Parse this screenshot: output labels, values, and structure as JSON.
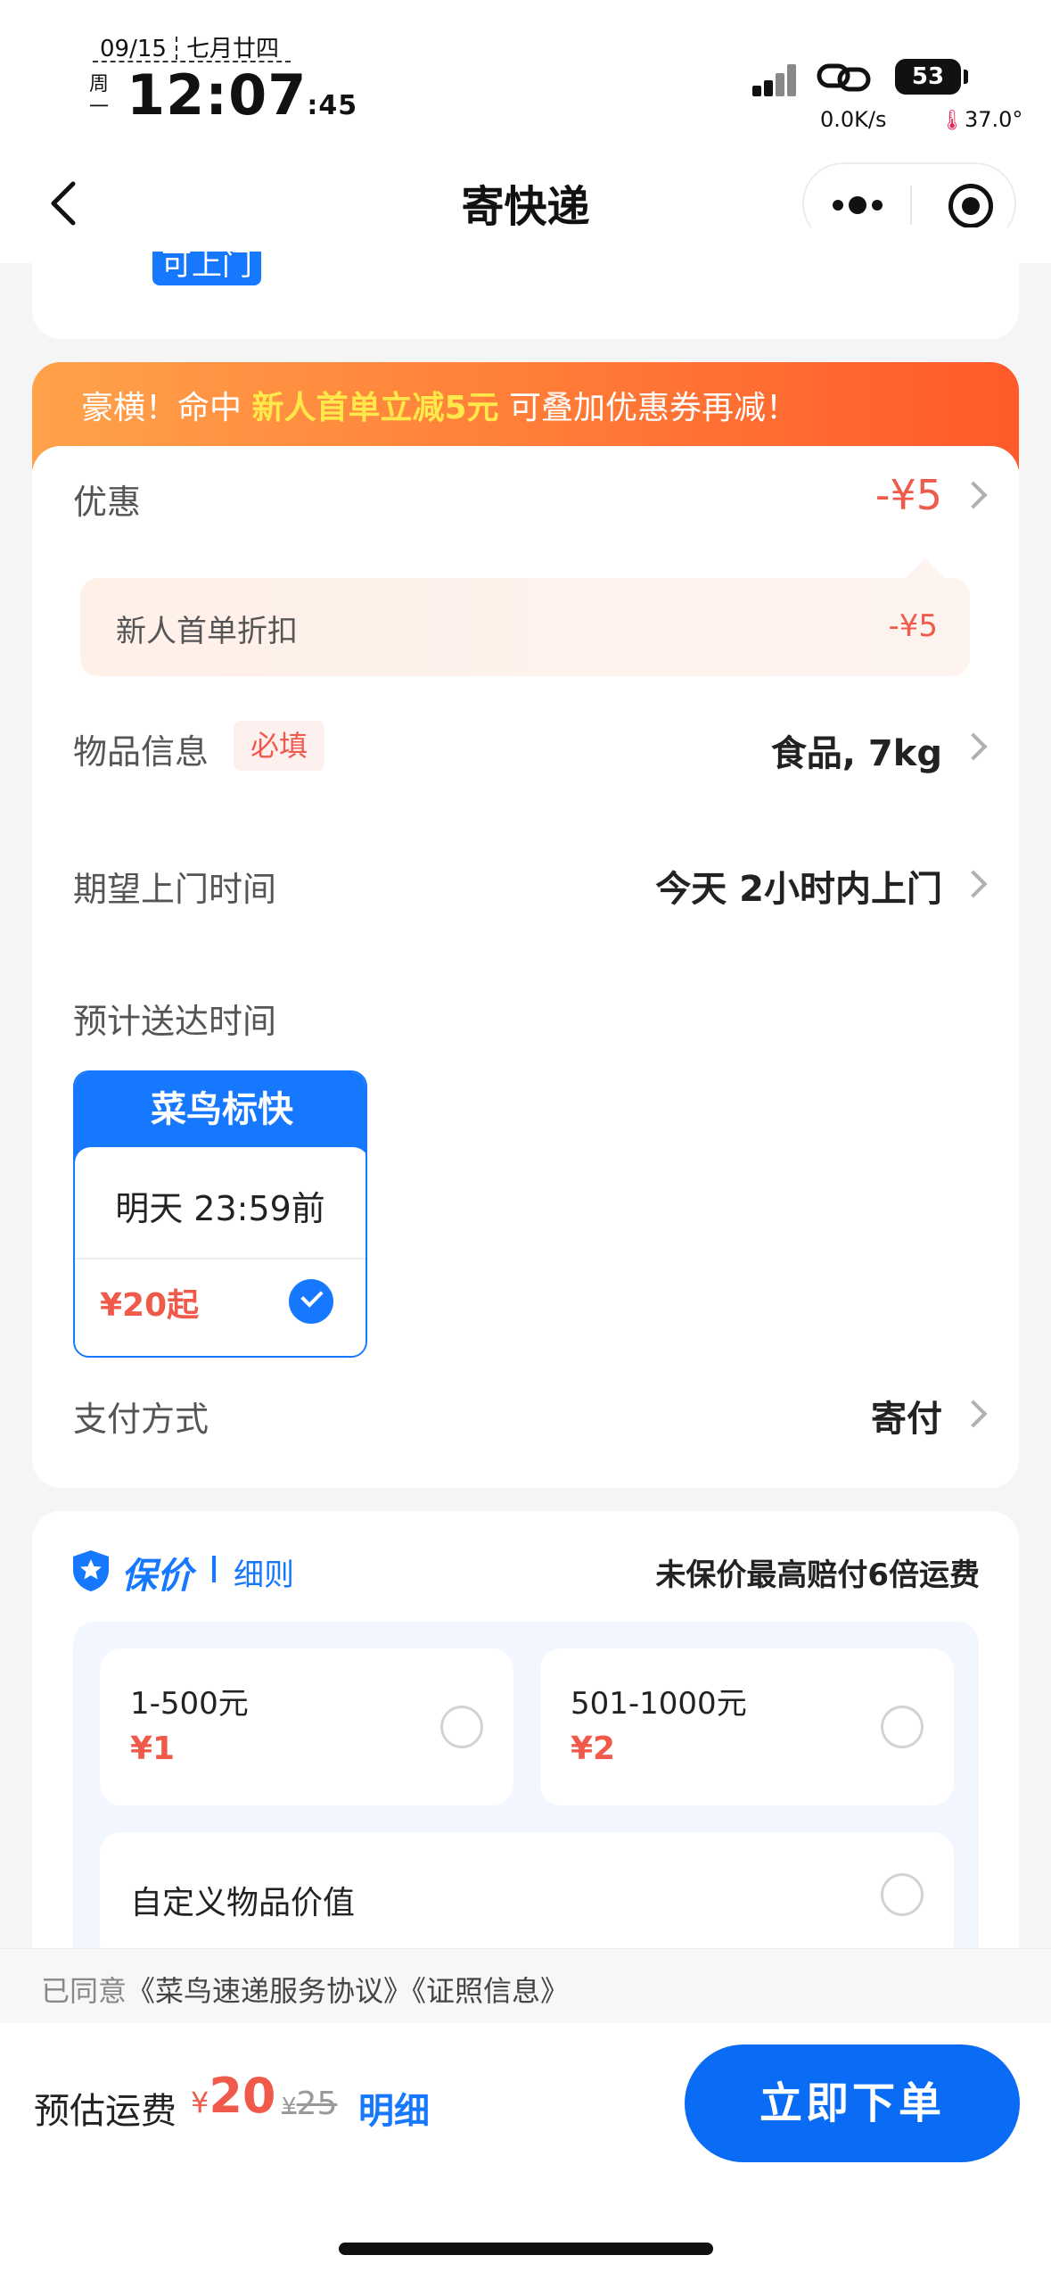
{
  "status_bar": {
    "date": "09/15",
    "lunar": "七月廿四",
    "weekday": "周一",
    "time": "12:07",
    "seconds": ":45",
    "battery": "53",
    "speed": "0.0K/s",
    "temperature": "37.0°"
  },
  "nav": {
    "title": "寄快递"
  },
  "top_card": {
    "tag": "可上门"
  },
  "banner": {
    "text_prefix": "豪横！命中 ",
    "text_highlight": "新人首单立减5元",
    "text_suffix": " 可叠加优惠券再减！"
  },
  "discount": {
    "label": "优惠",
    "value": "-¥5",
    "item_name": "新人首单折扣",
    "item_value": "-¥5"
  },
  "item_info": {
    "label": "物品信息",
    "required_tag": "必填",
    "value": "食品, 7kg"
  },
  "pickup_time": {
    "label": "期望上门时间",
    "value": "今天 2小时内上门"
  },
  "delivery": {
    "label": "预计送达时间",
    "option": {
      "name": "菜鸟标快",
      "eta": "明天 23:59前",
      "price": "¥20起",
      "selected": true
    }
  },
  "payment": {
    "label": "支付方式",
    "value": "寄付"
  },
  "insurance": {
    "title": "保价",
    "rules_link": "细则",
    "note": "未保价最高赔付6倍运费",
    "options": [
      {
        "range": "1-500元",
        "price": "¥1"
      },
      {
        "range": "501-1000元",
        "price": "¥2"
      }
    ],
    "custom_label": "自定义物品价值"
  },
  "agreement": {
    "prefix": "已同意",
    "link1": "《菜鸟速递服务协议》",
    "link2": "《证照信息》"
  },
  "bottom": {
    "estimate_label": "预估运费",
    "currency": "¥",
    "price": "20",
    "original_price": "25",
    "detail_label": "明细",
    "order_button": "立即下单"
  },
  "colors": {
    "accent": "#1677ff",
    "price_red": "#f05a4a",
    "banner_start": "#ffa24a",
    "banner_end": "#ff5a2a"
  }
}
